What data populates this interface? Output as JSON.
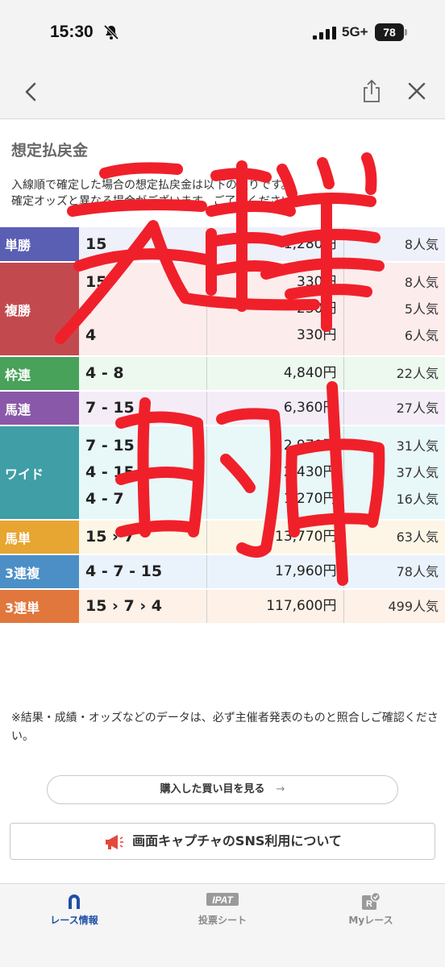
{
  "status_bar": {
    "time": "15:30",
    "network": "5G+",
    "battery": "78"
  },
  "nav": {
    "back_icon": "chevron-left-icon",
    "share_icon": "share-icon",
    "close_icon": "close-icon"
  },
  "section_title": "想定払戻金",
  "description": [
    "入線順で確定した場合の想定払戻金は以下の通りです。",
    "確定オッズと異なる場合がございます。ご了承ください。"
  ],
  "payout_rows": [
    {
      "category": "単勝",
      "color": "#5a5fb4",
      "bg": "#eef0fa",
      "lines": [
        {
          "combo": "15",
          "payout": "1,280円",
          "popularity": "8人気"
        }
      ]
    },
    {
      "category": "複勝",
      "color": "#c24a4f",
      "bg": "#fdecec",
      "lines": [
        {
          "combo": "15",
          "payout": "330円",
          "popularity": "8人気"
        },
        {
          "combo": "7",
          "payout": "230円",
          "popularity": "5人気"
        },
        {
          "combo": "4",
          "payout": "330円",
          "popularity": "6人気"
        }
      ]
    },
    {
      "category": "枠連",
      "color": "#48a25a",
      "bg": "#edf8ee",
      "lines": [
        {
          "combo": "4 - 8",
          "payout": "4,840円",
          "popularity": "22人気"
        }
      ]
    },
    {
      "category": "馬連",
      "color": "#8a58a8",
      "bg": "#f4edf8",
      "lines": [
        {
          "combo": "7 - 15",
          "payout": "6,360円",
          "popularity": "27人気"
        }
      ]
    },
    {
      "category": "ワイド",
      "color": "#3f9ea6",
      "bg": "#e8f7f8",
      "lines": [
        {
          "combo": "7 - 15",
          "payout": "2,970円",
          "popularity": "31人気"
        },
        {
          "combo": "4 - 15",
          "payout": "2,430円",
          "popularity": "37人気"
        },
        {
          "combo": "4 - 7",
          "payout": "1,270円",
          "popularity": "16人気"
        }
      ]
    },
    {
      "category": "馬単",
      "color": "#e7a531",
      "bg": "#fdf6e6",
      "lines": [
        {
          "combo": "15 › 7",
          "payout": "13,770円",
          "popularity": "63人気"
        }
      ]
    },
    {
      "category": "3連複",
      "color": "#4b8fc6",
      "bg": "#eaf3fb",
      "lines": [
        {
          "combo": "4 - 7 - 15",
          "payout": "17,960円",
          "popularity": "78人気"
        }
      ]
    },
    {
      "category": "3連単",
      "color": "#e1773d",
      "bg": "#fdf1e8",
      "lines": [
        {
          "combo": "15 › 7 › 4",
          "payout": "117,600円",
          "popularity": "499人気"
        }
      ]
    }
  ],
  "note": "※結果・成績・オッズなどのデータは、必ず主催者発表のものと照合しご確認ください。",
  "buttons": {
    "bought_label": "購入した買い目を見る",
    "bought_arrow": "→",
    "sns_label": "画面キャプチャのSNS利用について"
  },
  "tabs": [
    {
      "label": "レース情報",
      "icon": "horseshoe-icon",
      "active": true
    },
    {
      "label": "投票シート",
      "icon": "ipat-icon",
      "icon_text": "IPAT",
      "active": false
    },
    {
      "label": "Myレース",
      "icon": "my-race-icon",
      "icon_text": "R",
      "active": false
    }
  ],
  "handwriting": "三連単的中",
  "colors": {
    "accent": "#1f4fa8",
    "scribble": "#f0202a"
  }
}
